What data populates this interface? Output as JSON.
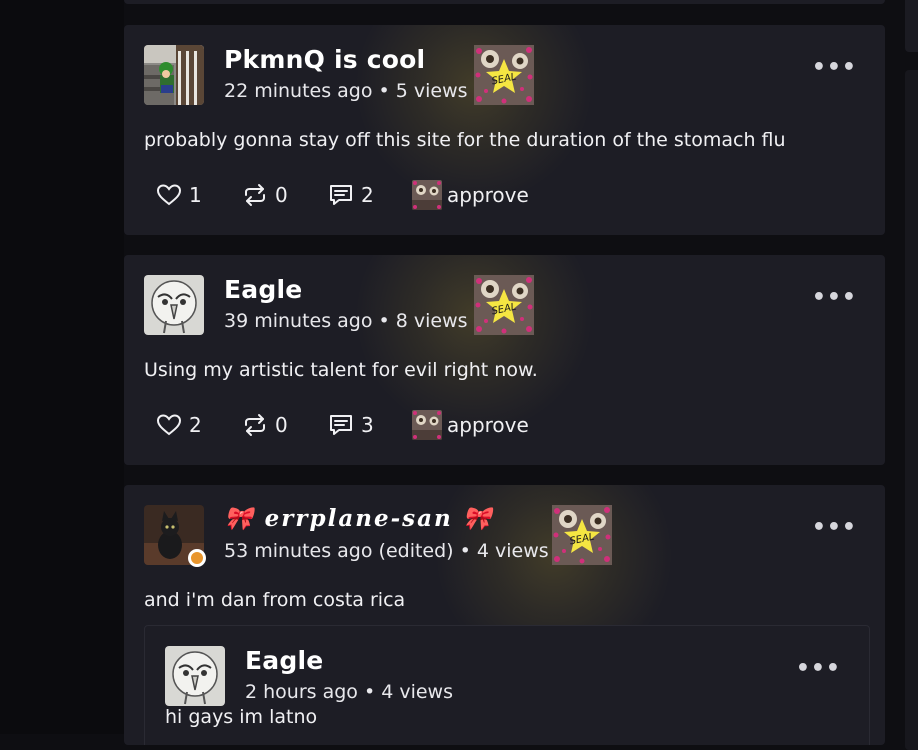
{
  "posts": [
    {
      "author": "PkmnQ is cool",
      "meta": "22 minutes ago • 5 views",
      "body": "probably gonna stay off this site for the duration of the stomach flu",
      "likes": "1",
      "reposts": "0",
      "comments": "2",
      "reaction": "approve",
      "more": "•••"
    },
    {
      "author": "Eagle",
      "meta": "39 minutes ago • 8 views",
      "body": "Using my artistic talent for evil right now.",
      "likes": "2",
      "reposts": "0",
      "comments": "3",
      "reaction": "approve",
      "more": "•••"
    },
    {
      "author": "🎀 𝒆𝒓𝒓𝒑𝒍𝒂𝒏𝒆-𝒔𝒂𝒏 🎀",
      "meta": "53 minutes ago (edited) • 4 views",
      "body": "and i'm dan from costa rica",
      "more": "•••",
      "quoted": {
        "author": "Eagle",
        "meta": "2 hours ago • 4 views",
        "body": "hi gays im latno",
        "more": "•••"
      }
    }
  ],
  "seal_text": "SEAL",
  "colors": {
    "background": "#0e0e12",
    "card": "#1d1d25",
    "online_status": "#e8952d",
    "seal_star": "#f5e642",
    "seal_pink": "#d0307a"
  },
  "icons": [
    "heart-icon",
    "repost-icon",
    "comment-icon",
    "more-icon",
    "seal-badge",
    "reaction-sticker"
  ]
}
